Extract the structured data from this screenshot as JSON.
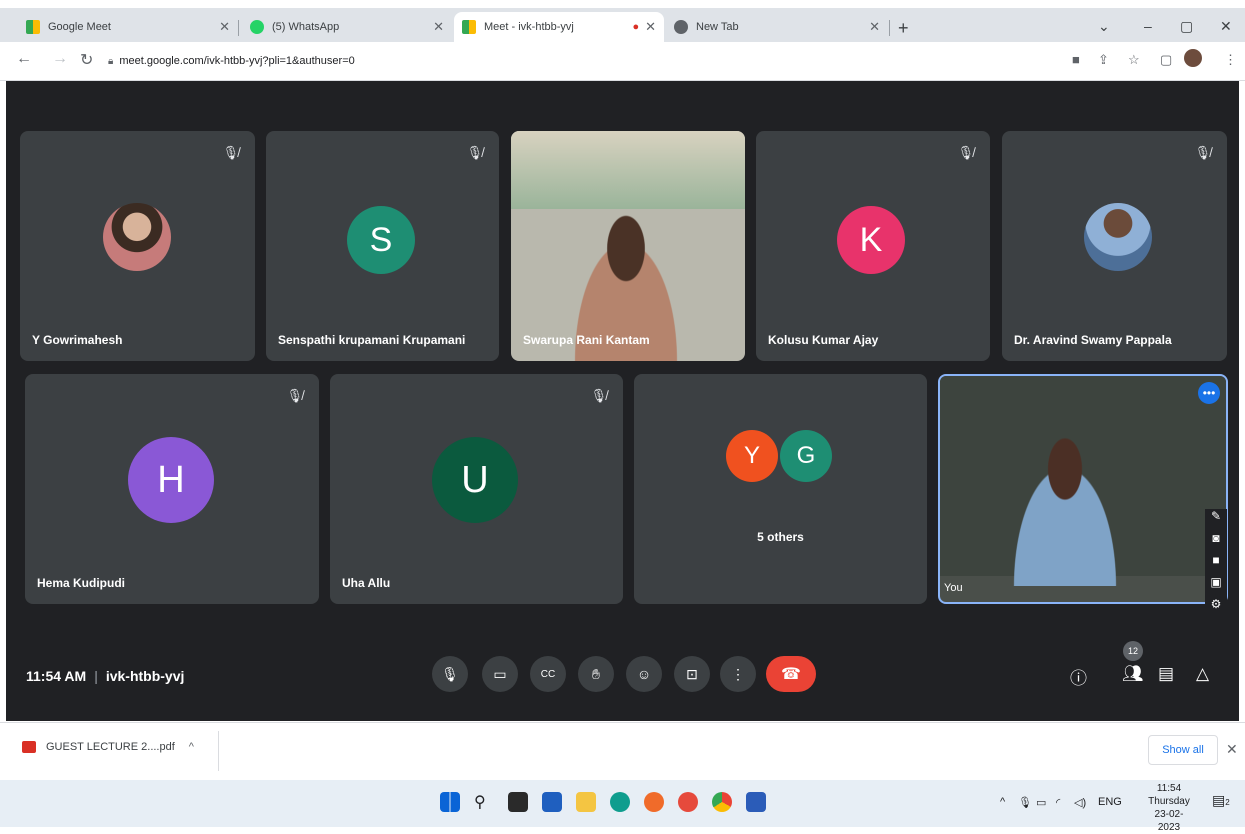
{
  "browser": {
    "tabs": [
      {
        "title": "Google Meet",
        "active": false
      },
      {
        "title": "(5) WhatsApp",
        "active": false
      },
      {
        "title": "Meet - ivk-htbb-yvj",
        "active": true
      },
      {
        "title": "New Tab",
        "active": false
      }
    ],
    "url": "meet.google.com/ivk-htbb-yvj?pli=1&authuser=0"
  },
  "participants_row1": [
    {
      "name": "Y Gowrimahesh",
      "type": "photo"
    },
    {
      "name": "Senspathi krupamani Krupamani",
      "initial": "S",
      "color": "#1e8e73"
    },
    {
      "name": "Swarupa Rani Kantam",
      "type": "video"
    },
    {
      "name": "Kolusu Kumar Ajay",
      "initial": "K",
      "color": "#e8336b"
    },
    {
      "name": "Dr. Aravind Swamy Pappala",
      "type": "photo"
    }
  ],
  "participants_row2": [
    {
      "name": "Hema Kudipudi",
      "initial": "H",
      "color": "#8a58d6"
    },
    {
      "name": "Uha Allu",
      "initial": "U",
      "color": "#0b5a3e"
    }
  ],
  "others_tile": {
    "initials": [
      "Y",
      "G"
    ],
    "colors": [
      "#f0511f",
      "#1e8e73"
    ],
    "label": "5 others"
  },
  "self_tile": {
    "name": "You"
  },
  "meeting": {
    "time": "11:54 AM",
    "code": "ivk-htbb-yvj",
    "participant_count": "12"
  },
  "download": {
    "filename": "GUEST LECTURE 2....pdf",
    "show_all": "Show all"
  },
  "taskbar": {
    "lang": "ENG",
    "time": "11:54",
    "day": "Thursday",
    "date": "23-02-2023",
    "notifications": "2"
  }
}
